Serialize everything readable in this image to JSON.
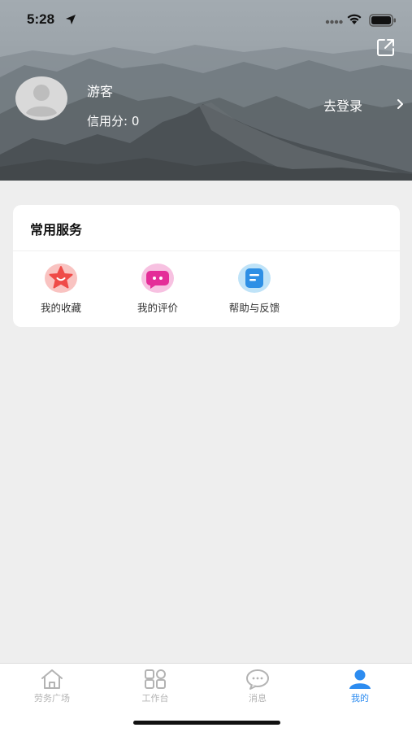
{
  "status_bar": {
    "time": "5:28"
  },
  "profile": {
    "name": "游客",
    "credit_text": "信用分: 0",
    "login_label": "去登录"
  },
  "services": {
    "title": "常用服务",
    "items": [
      {
        "label": "我的收藏",
        "icon": "star-favorite-icon",
        "color": "#f0524f"
      },
      {
        "label": "我的评价",
        "icon": "chat-bubble-icon",
        "color": "#e6329b"
      },
      {
        "label": "帮助与反馈",
        "icon": "feedback-doc-icon",
        "color": "#2f8fe6"
      }
    ]
  },
  "tabbar": {
    "tabs": [
      {
        "label": "劳务广场",
        "icon": "home-icon",
        "active": false
      },
      {
        "label": "工作台",
        "icon": "grid-icon",
        "active": false
      },
      {
        "label": "消息",
        "icon": "message-icon",
        "active": false
      },
      {
        "label": "我的",
        "icon": "user-icon",
        "active": true
      }
    ],
    "active_color": "#2d8cf0",
    "inactive_color": "#b3b3b3"
  }
}
